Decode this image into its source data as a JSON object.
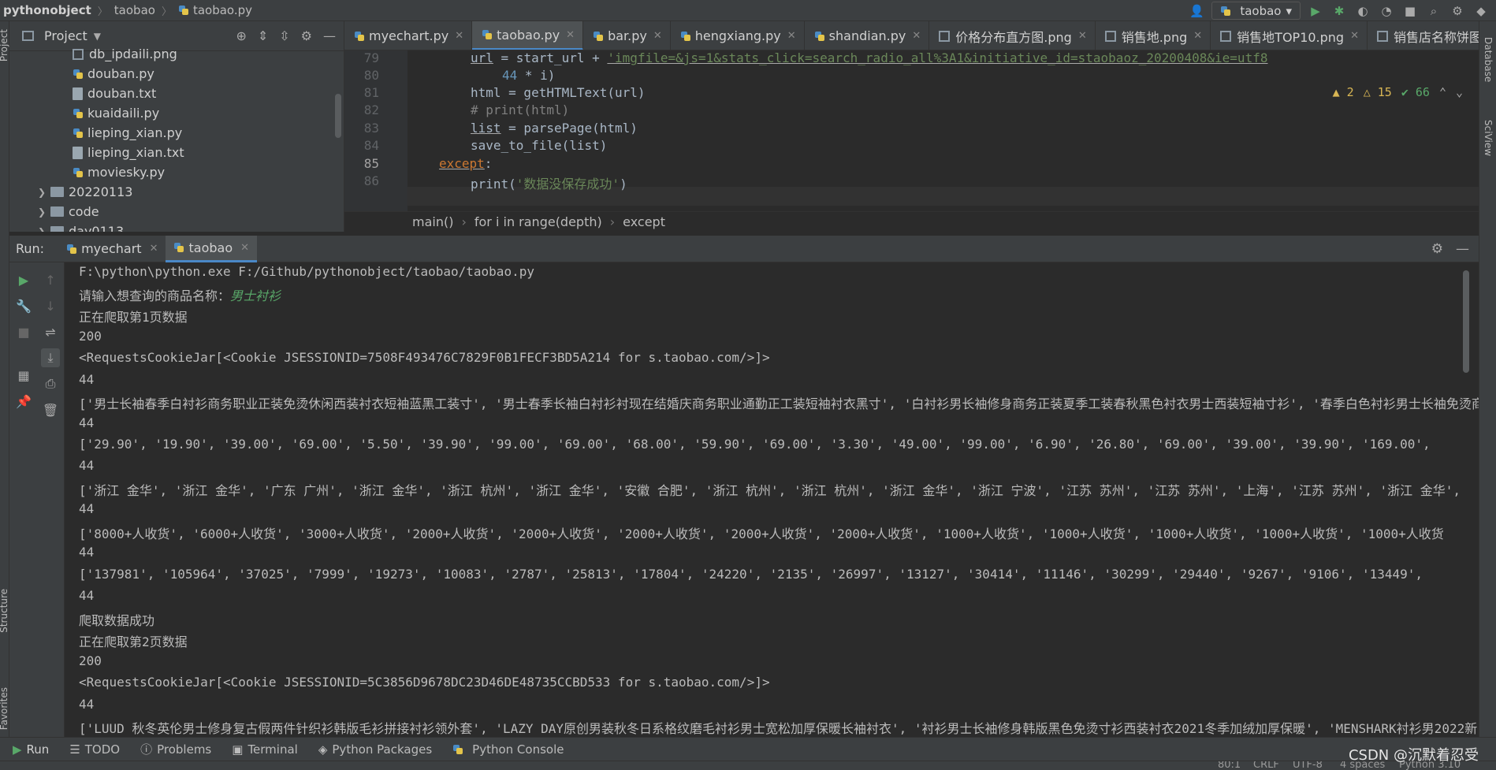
{
  "navbar": {
    "project": "pythonobject",
    "folder": "taobao",
    "file": "taobao.py",
    "run_config": "taobao"
  },
  "project_panel": {
    "title": "Project",
    "files": [
      "db_ipdaili.png",
      "douban.py",
      "douban.txt",
      "kuaidaili.py",
      "lieping_xian.py",
      "lieping_xian.txt",
      "moviesky.py"
    ],
    "folders": [
      "20220113",
      "code",
      "day0113"
    ]
  },
  "editor": {
    "tabs": [
      "myechart.py",
      "taobao.py",
      "bar.py",
      "hengxiang.py",
      "shandian.py",
      "价格分布直方图.png",
      "销售地.png",
      "销售地TOP10.png",
      "销售店名称饼图分析"
    ],
    "lines": {
      "n79": "79",
      "n80": "80",
      "n81": "81",
      "n82": "82",
      "n83": "83",
      "n84": "84",
      "n85": "85",
      "n86": "86",
      "l79_a": "url",
      "l79_b": " = start_url + ",
      "l79_c": "'imgfile=&js=1&stats_click=search_radio_all%3A1&initiative_id=staobaoz_20200408&ie=utf8",
      "l80_a": "44",
      "l80_b": " * i)",
      "l81": "html = getHTMLText(url)",
      "l82": "# print(html)",
      "l83_a": "list",
      "l83_b": " = parsePage(html)",
      "l84": "save_to_file(list)",
      "l85_a": "except",
      "l85_b": ":",
      "l86_a": "print(",
      "l86_b": "'数据没保存成功'",
      "l86_c": ")"
    },
    "inspections": {
      "errors": "2",
      "warnings": "15",
      "ok": "66"
    },
    "breadcrumb": [
      "main()",
      "for i in range(depth)",
      "except"
    ]
  },
  "run": {
    "label": "Run:",
    "tabs": [
      "myechart",
      "taobao"
    ],
    "output": {
      "cmd": "F:\\python\\python.exe F:/Github/pythonobject/taobao/taobao.py",
      "prompt": "请输入想查询的商品名称：",
      "user_input": "男士衬衫",
      "crawl1": "正在爬取第1页数据",
      "status1": "200",
      "cookie1": "<RequestsCookieJar[<Cookie JSESSIONID=7508F493476C7829F0B1FECF3BD5A214 for s.taobao.com/>]>",
      "count1": "44",
      "titles1": "['男士长袖春季白衬衫商务职业正装免烫休闲西装衬衣短袖蓝黑工装寸', '男士春季长袖白衬衫衬现在结婚庆商务职业通勤正工装短袖衬衣黑寸', '白衬衫男长袖修身商务正装夏季工装春秋黑色衬衣男士西装短袖寸衫', '春季白色衬衫男士长袖免烫商",
      "count2": "44",
      "prices1": "['29.90', '19.90', '39.00', '69.00', '5.50', '39.90', '99.00', '69.00', '68.00', '59.90', '69.00', '3.30', '49.00', '99.00', '6.90', '26.80', '69.00', '39.00', '39.90', '169.00',",
      "count3": "44",
      "locations1": "['浙江 金华', '浙江 金华', '广东 广州', '浙江 金华', '浙江 杭州', '浙江 金华', '安徽 合肥', '浙江 杭州', '浙江 杭州', '浙江 金华', '浙江 宁波', '江苏 苏州', '江苏 苏州', '上海', '江苏 苏州', '浙江 金华',",
      "count4": "44",
      "sales1": "['8000+人收货', '6000+人收货', '3000+人收货', '2000+人收货', '2000+人收货', '2000+人收货', '2000+人收货', '2000+人收货', '1000+人收货', '1000+人收货', '1000+人收货', '1000+人收货', '1000+人收货",
      "count5": "44",
      "comments1": "['137981', '105964', '37025', '7999', '19273', '10083', '2787', '25813', '17804', '24220', '2135', '26997', '13127', '30414', '11146', '30299', '29440', '9267', '9106', '13449',",
      "count6": "44",
      "success1": "爬取数据成功",
      "crawl2": "正在爬取第2页数据",
      "status2": "200",
      "cookie2": "<RequestsCookieJar[<Cookie JSESSIONID=5C3856D9678DC23D46DE48735CCBD533 for s.taobao.com/>]>",
      "count7": "44",
      "titles2": "['LUUD 秋冬英伦男士修身复古假两件针织衫韩版毛衫拼接衬衫领外套', 'LAZY DAY原创男装秋冬日系格纹磨毛衬衫男士宽松加厚保暖长袖衬衣', '衬衫男士长袖修身韩版黑色免烫寸衫西装衬衣2021冬季加绒加厚保暖', 'MENSHARK衬衫男2022新"
    }
  },
  "bottom_tabs": [
    "Run",
    "TODO",
    "Problems",
    "Terminal",
    "Python Packages",
    "Python Console"
  ],
  "statusbar": {
    "position": "80:1",
    "line_sep": "CRLF",
    "encoding": "UTF-8",
    "indent": "4 spaces",
    "interpreter": "Python 3.10"
  },
  "watermark": "CSDN @沉默着忍受"
}
